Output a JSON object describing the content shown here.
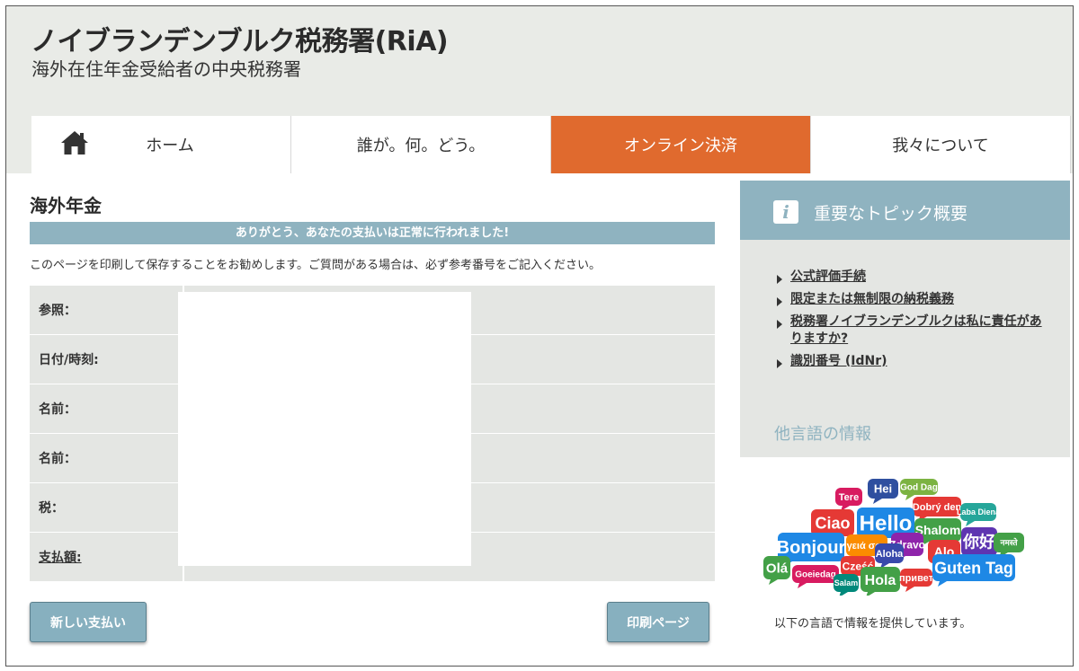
{
  "header": {
    "title": "ノイブランデンブルク税務署(RiA)",
    "subtitle": "海外在住年金受給者の中央税務署"
  },
  "nav": {
    "items": [
      {
        "label": "ホーム",
        "icon": "home-icon"
      },
      {
        "label": "誰が。何。どう。"
      },
      {
        "label": "オンライン決済",
        "active": true
      },
      {
        "label": "我々について"
      }
    ],
    "active_color": "#e06a2e"
  },
  "main": {
    "heading": "海外年金",
    "success_message": "ありがとう、あなたの支払いは正常に行われました!",
    "info_text": "このページを印刷して保存することをお勧めします。ご質問がある場合は、必ず参考番号をご記入ください。",
    "rows": [
      {
        "label": "参照：",
        "value": ""
      },
      {
        "label": "日付/時刻:",
        "value": ""
      },
      {
        "label": "名前：",
        "value": ""
      },
      {
        "label": "名前：",
        "value": ""
      },
      {
        "label": "税：",
        "value": ""
      },
      {
        "label": "支払額:",
        "value": ""
      }
    ],
    "new_payment_label": "新しい支払い",
    "print_label": "印刷ページ"
  },
  "sidebar": {
    "title": "重要なトピック概要",
    "topics": [
      "公式評価手続",
      "限定または無制限の納税義務",
      "税務署ノイブランデンブルクは私に責任がありますか?",
      "識別番号 (IdNr)"
    ],
    "other_lang_heading": "他言語の情報",
    "lang_words": [
      "Hei",
      "God Dag",
      "Tere",
      "Dobrý den",
      "Ciao",
      "Hello",
      "Laba Diena",
      "Shalom",
      "Bonjour",
      "γειά σου",
      "Zdravo",
      "Alo",
      "你好",
      "नमस्ते",
      "Olá",
      "Cześć",
      "Aloha",
      "Goeiedag",
      "Salam",
      "Hola",
      "привет",
      "Guten Tag"
    ],
    "lang_caption": "以下の言語で情報を提供しています。",
    "accent_color": "#8fb3c0"
  }
}
